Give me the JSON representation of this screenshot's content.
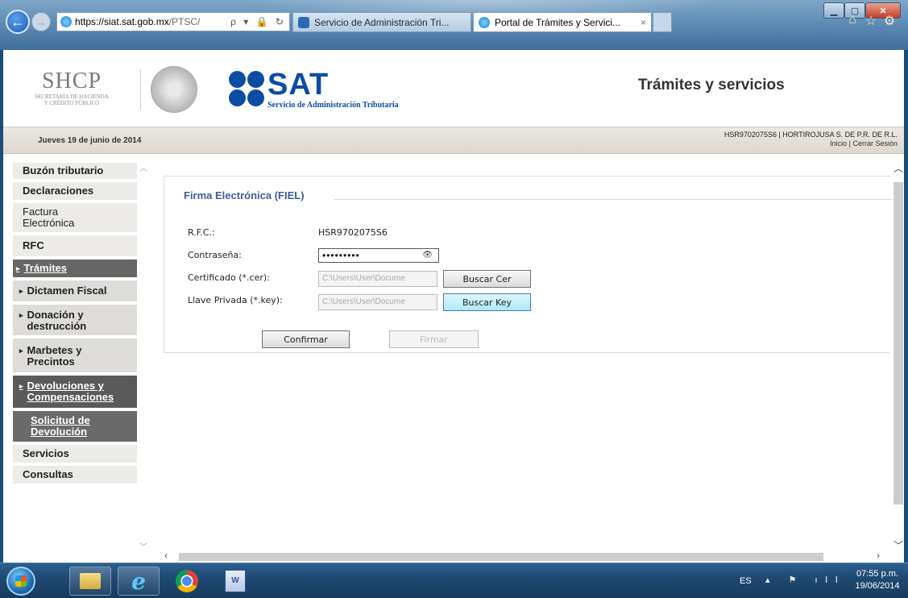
{
  "browser": {
    "address_url_host": "https://siat.sat.gob.mx",
    "address_url_path": "/PTSC/",
    "address_controls": "ρ ▾ 🔒 ↻",
    "tabs": [
      {
        "label": "Servicio de Administración Tri..."
      },
      {
        "label": "Portal de Trámites y Servici..."
      }
    ],
    "tab_close": "×"
  },
  "header": {
    "shcp_logo_text": "SHCP",
    "shcp_logo_sub_1": "SECRETARÍA DE HACIENDA",
    "shcp_logo_sub_2": "Y CRÉDITO PÚBLICO",
    "sat_logo_text": "SAT",
    "sat_logo_sub": "Servicio de Administración Tributaria",
    "title": "Trámites y servicios"
  },
  "info_bar": {
    "date": "Jueves 19 de junio de 2014",
    "user": "HSR9702075S6 | HORTIROJUSA S. DE P.R. DE R.L.",
    "links": "Inicio | Cerrar Sesión"
  },
  "sidebar": {
    "items": [
      {
        "label": "Buzón tributario"
      },
      {
        "label": "Declaraciones"
      },
      {
        "label": "Factura Electrónica"
      },
      {
        "label": "RFC"
      },
      {
        "label": "Trámites"
      },
      {
        "label": "Dictamen Fiscal"
      },
      {
        "label": "Donación y destrucción"
      },
      {
        "label": "Marbetes y Precintos"
      },
      {
        "label": "Devoluciones y Compensaciones"
      },
      {
        "label": "Solicitud de Devolución"
      },
      {
        "label": "Servicios"
      },
      {
        "label": "Consultas"
      }
    ]
  },
  "fiel": {
    "title": "Firma Electrónica (FIEL)",
    "rfc_label": "R.F.C.:",
    "rfc_value": "HSR9702075S6",
    "password_label": "Contraseña:",
    "password_value": "•••••••••",
    "cert_label": "Certificado (*.cer):",
    "cert_value": "C:\\Users\\User\\Docume",
    "cert_button": "Buscar Cer",
    "key_label": "Llave Privada (*.key):",
    "key_value": "C:\\Users\\User\\Docume",
    "key_button": "Buscar Key",
    "confirm_button": "Confirmar",
    "sign_button": "Firmar"
  },
  "taskbar": {
    "language": "ES",
    "clock_time": "07:55 p.m.",
    "clock_date": "19/06/2014"
  },
  "colors": {
    "sat_blue": "#0a4da3",
    "fiel_title": "#3a5f93",
    "nav_active": "#666666",
    "key_button": "#aee8f9"
  },
  "icons": {
    "back": "back-arrow-icon",
    "forward": "forward-arrow-icon",
    "home": "home-icon",
    "favorites": "star-icon",
    "tools": "gear-icon",
    "start": "windows-start-icon"
  }
}
